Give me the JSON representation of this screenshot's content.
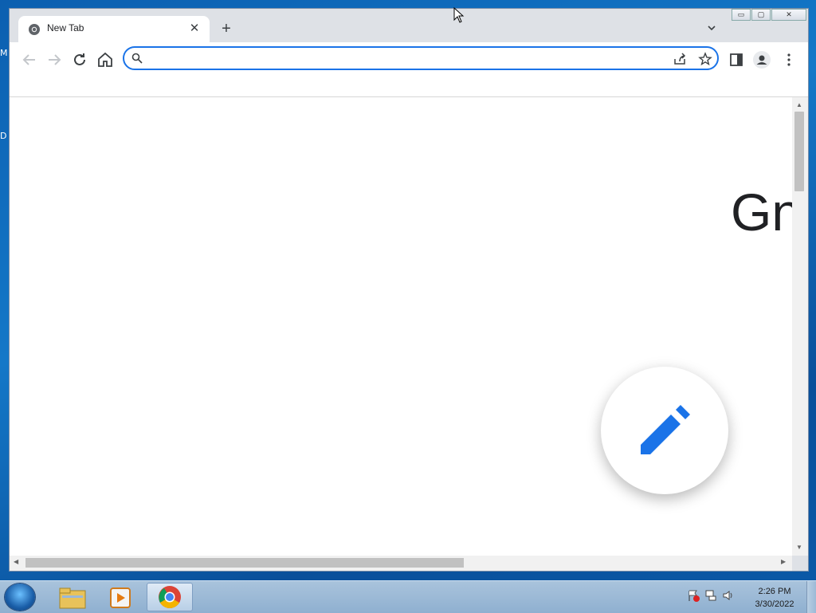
{
  "desktop": {
    "label_m": "M",
    "label_d": "D"
  },
  "browser": {
    "tab": {
      "title": "New Tab"
    },
    "window_buttons": {
      "minimize": "▭",
      "maximize": "▢",
      "close": "✕"
    },
    "omnibox": {
      "value": "",
      "placeholder": ""
    },
    "page": {
      "partial_text": "Gn"
    }
  },
  "taskbar": {
    "apps": [
      "file-explorer",
      "media-player",
      "chrome"
    ],
    "clock": {
      "time": "2:26 PM",
      "date": "3/30/2022"
    }
  },
  "colors": {
    "accent": "#1a73e8",
    "tab_strip": "#dee1e6"
  }
}
